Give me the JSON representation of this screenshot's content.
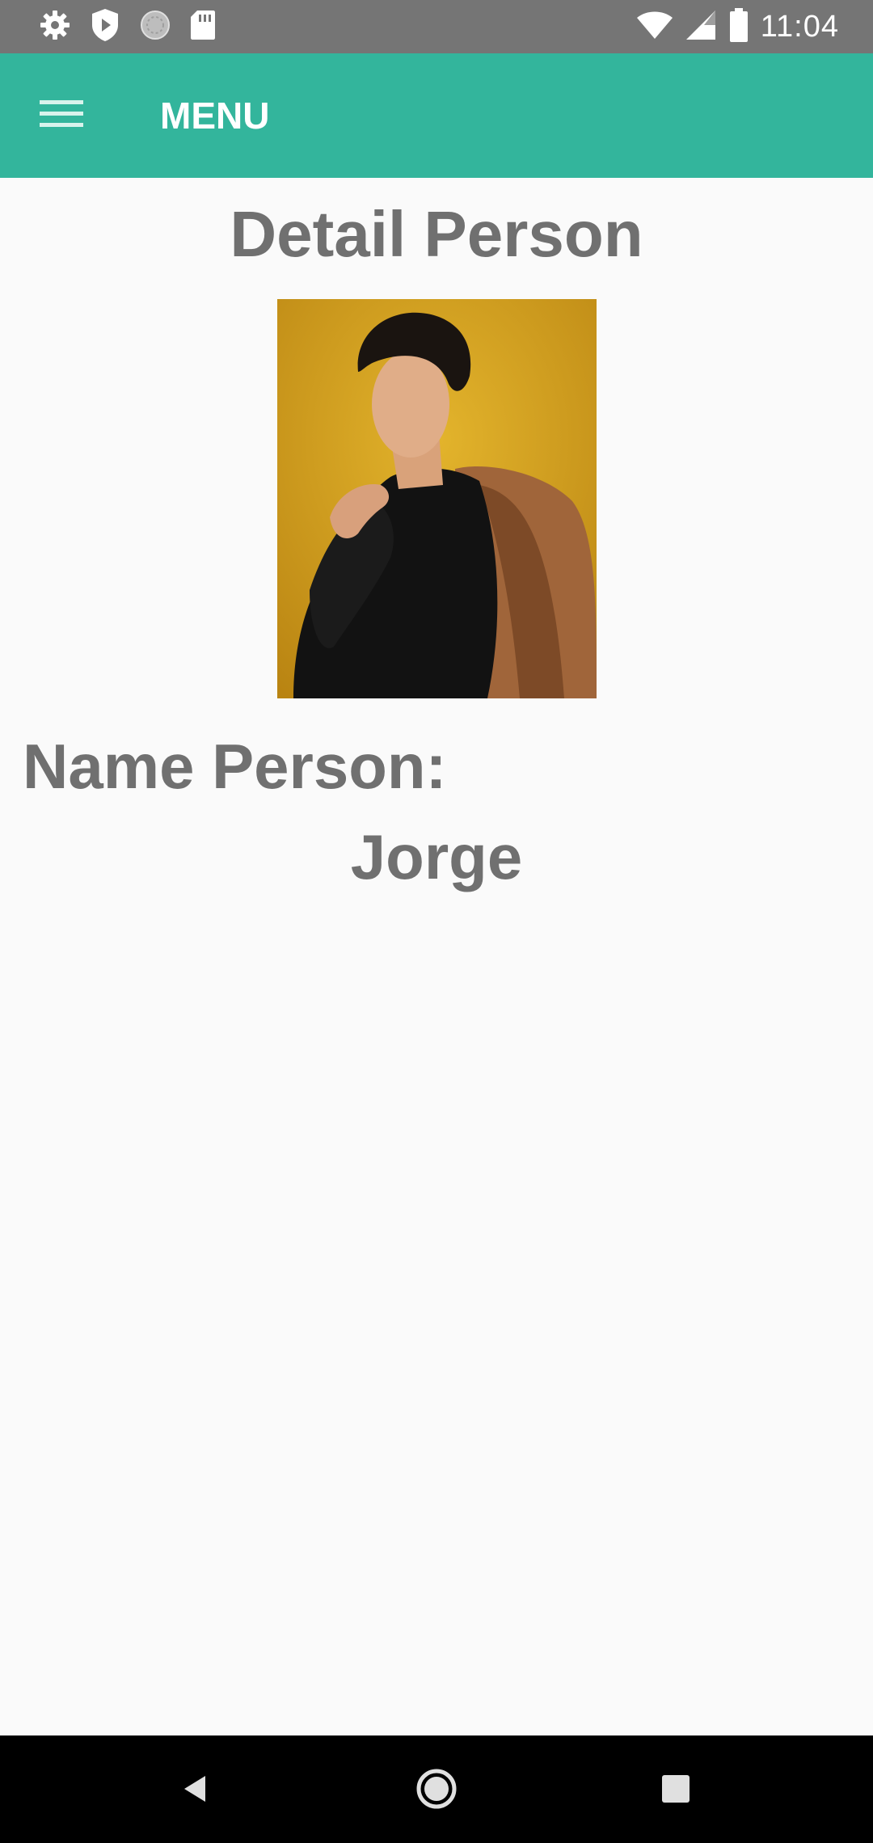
{
  "status_bar": {
    "time": "11:04",
    "left_icons": [
      "settings-icon",
      "shield-play-icon",
      "sync-circle-icon",
      "sd-card-icon"
    ],
    "right_icons": [
      "wifi-icon",
      "cell-signal-icon",
      "battery-icon"
    ]
  },
  "app_bar": {
    "title": "MENU",
    "menu_icon": "hamburger-menu-icon",
    "color": "#33b59c"
  },
  "content": {
    "page_title": "Detail Person",
    "name_label": "Name Person:",
    "name_value": "Jorge",
    "text_color": "#707070"
  },
  "nav_bar": {
    "icons": [
      "back-icon",
      "home-icon",
      "recents-icon"
    ]
  }
}
